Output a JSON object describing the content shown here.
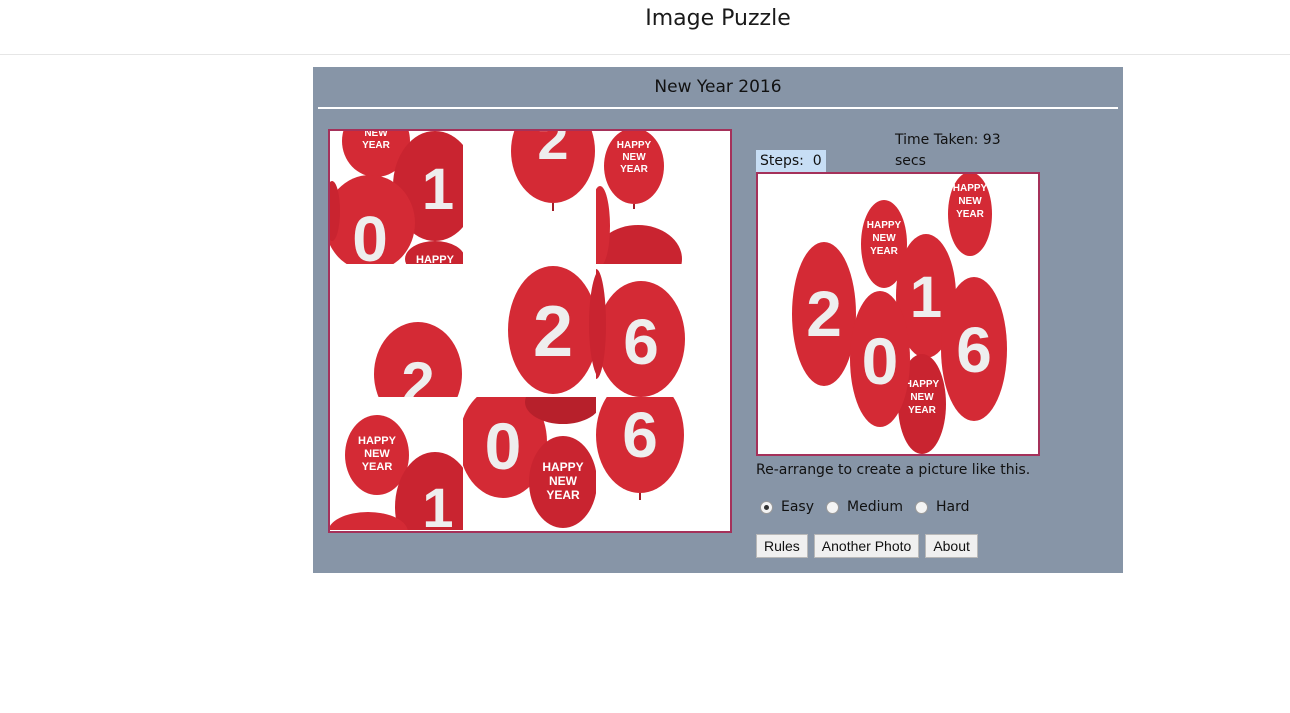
{
  "app": {
    "title": "Image Puzzle"
  },
  "puzzle": {
    "name": "New Year 2016",
    "steps_label": "Steps:",
    "steps_value": "0",
    "time_label": "Time Taken: 93 secs",
    "instruction": "Re-arrange to create a picture like this."
  },
  "balloon_text": {
    "greeting": [
      "HAPPY",
      "NEW",
      "YEAR"
    ],
    "digits": [
      "2",
      "0",
      "1",
      "6"
    ]
  },
  "levels": [
    {
      "label": "Easy",
      "selected": true
    },
    {
      "label": "Medium",
      "selected": false
    },
    {
      "label": "Hard",
      "selected": false
    }
  ],
  "buttons": {
    "rules": "Rules",
    "another_photo": "Another Photo",
    "about": "About"
  },
  "colors": {
    "panel": "#8795a7",
    "border": "#a5315a",
    "balloon": "#d42a35",
    "steps_bg": "#c7def5"
  }
}
